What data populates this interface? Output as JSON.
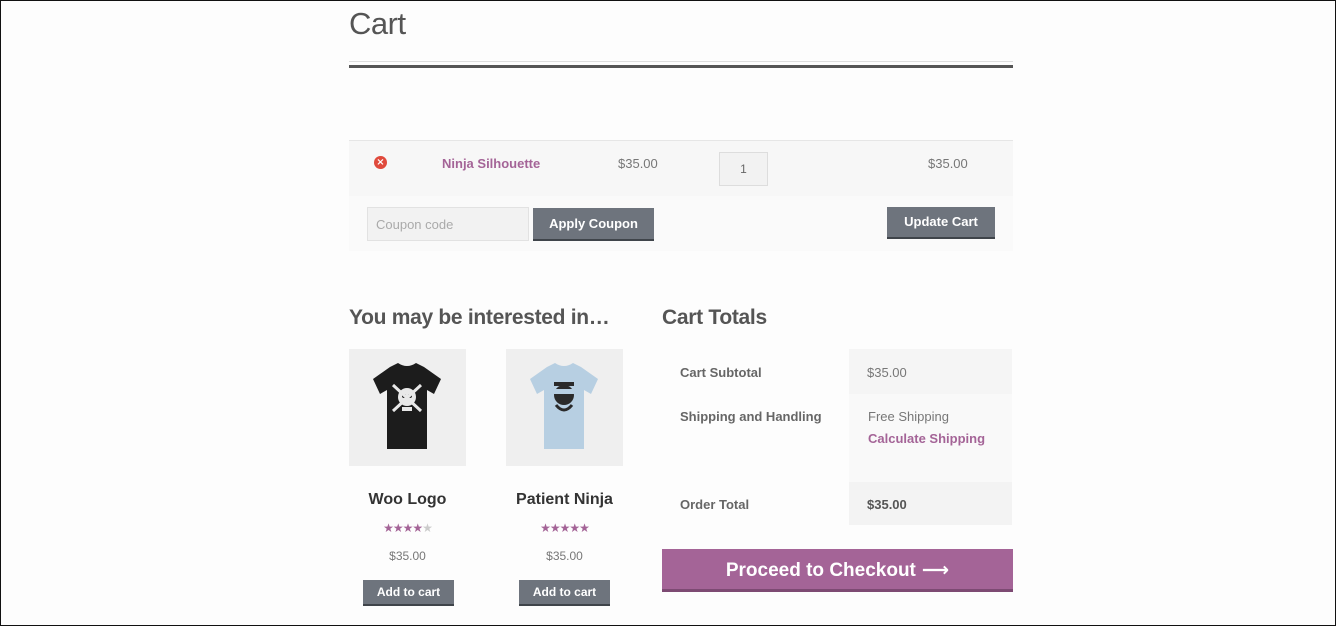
{
  "page": {
    "title": "Cart"
  },
  "cart": {
    "item": {
      "remove_glyph": "×",
      "name": "Ninja Silhouette",
      "price": "$35.00",
      "quantity": "1",
      "subtotal": "$35.00"
    },
    "coupon": {
      "placeholder": "Coupon code",
      "apply_label": "Apply Coupon"
    },
    "update_label": "Update Cart"
  },
  "cross_sells": {
    "heading": "You may be interested in…",
    "products": [
      {
        "name": "Woo Logo",
        "rating": 4,
        "rating_max": 5,
        "price": "$35.00",
        "button": "Add to cart",
        "shirt_color": "#1c1c1c"
      },
      {
        "name": "Patient Ninja",
        "rating": 4.5,
        "rating_max": 5,
        "price": "$35.00",
        "button": "Add to cart",
        "shirt_color": "#b7cfe2"
      }
    ]
  },
  "totals": {
    "heading": "Cart Totals",
    "subtotal_label": "Cart Subtotal",
    "subtotal_value": "$35.00",
    "shipping_label": "Shipping and Handling",
    "shipping_value": "Free Shipping",
    "calc_shipping": "Calculate Shipping",
    "order_total_label": "Order Total",
    "order_total_value": "$35.00"
  },
  "checkout": {
    "label": "Proceed to Checkout",
    "arrow": "⟶"
  },
  "colors": {
    "accent": "#a46497",
    "button": "#6e747d",
    "remove": "#e04a3c"
  }
}
